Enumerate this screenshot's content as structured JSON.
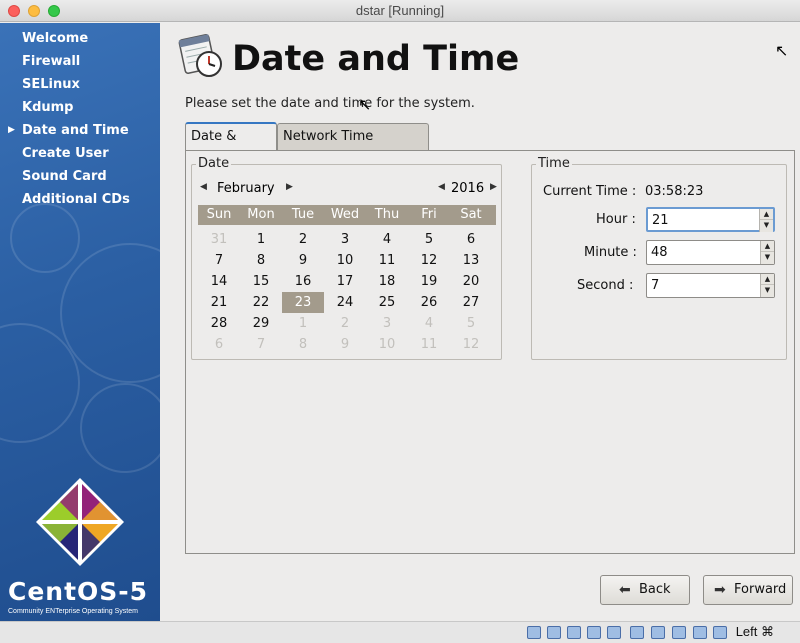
{
  "window": {
    "title": "dstar [Running]"
  },
  "sidebar": {
    "items": [
      {
        "label": "Welcome",
        "current": false
      },
      {
        "label": "Firewall",
        "current": false
      },
      {
        "label": "SELinux",
        "current": false
      },
      {
        "label": "Kdump",
        "current": false
      },
      {
        "label": "Date and Time",
        "current": true
      },
      {
        "label": "Create User",
        "current": false
      },
      {
        "label": "Sound Card",
        "current": false
      },
      {
        "label": "Additional CDs",
        "current": false
      }
    ],
    "brand": "CentOS-5",
    "brand_tagline": "Community ENTerprise Operating System"
  },
  "page": {
    "title": "Date and Time",
    "instruction": "Please set the date and time for the system."
  },
  "tabs": [
    {
      "label": "Date & Time",
      "active": true
    },
    {
      "label": "Network Time Protocol",
      "active": false
    }
  ],
  "date_frame": {
    "label": "Date",
    "month": "February",
    "year": "2016",
    "weekdays": [
      "Sun",
      "Mon",
      "Tue",
      "Wed",
      "Thu",
      "Fri",
      "Sat"
    ],
    "weeks": [
      [
        {
          "d": "31",
          "dim": true
        },
        {
          "d": "1"
        },
        {
          "d": "2"
        },
        {
          "d": "3"
        },
        {
          "d": "4"
        },
        {
          "d": "5"
        },
        {
          "d": "6"
        }
      ],
      [
        {
          "d": "7"
        },
        {
          "d": "8"
        },
        {
          "d": "9"
        },
        {
          "d": "10"
        },
        {
          "d": "11"
        },
        {
          "d": "12"
        },
        {
          "d": "13"
        }
      ],
      [
        {
          "d": "14"
        },
        {
          "d": "15"
        },
        {
          "d": "16"
        },
        {
          "d": "17"
        },
        {
          "d": "18"
        },
        {
          "d": "19"
        },
        {
          "d": "20"
        }
      ],
      [
        {
          "d": "21"
        },
        {
          "d": "22"
        },
        {
          "d": "23",
          "selected": true
        },
        {
          "d": "24"
        },
        {
          "d": "25"
        },
        {
          "d": "26"
        },
        {
          "d": "27"
        }
      ],
      [
        {
          "d": "28"
        },
        {
          "d": "29"
        },
        {
          "d": "1",
          "dim": true
        },
        {
          "d": "2",
          "dim": true
        },
        {
          "d": "3",
          "dim": true
        },
        {
          "d": "4",
          "dim": true
        },
        {
          "d": "5",
          "dim": true
        }
      ],
      [
        {
          "d": "6",
          "dim": true
        },
        {
          "d": "7",
          "dim": true
        },
        {
          "d": "8",
          "dim": true
        },
        {
          "d": "9",
          "dim": true
        },
        {
          "d": "10",
          "dim": true
        },
        {
          "d": "11",
          "dim": true
        },
        {
          "d": "12",
          "dim": true
        }
      ]
    ]
  },
  "time_frame": {
    "label": "Time",
    "current_time_label": "Current Time :",
    "current_time": "03:58:23",
    "hour_label": "Hour :",
    "hour": "21",
    "minute_label": "Minute :",
    "minute": "48",
    "second_label": "Second :",
    "second": "7"
  },
  "buttons": {
    "back": "Back",
    "forward": "Forward"
  },
  "statusbar": {
    "host_key": "Left ⌘"
  },
  "colors": {
    "sidebar": "#2b5fa3",
    "calendar_header": "#a39b8c",
    "tab_accent": "#3677c2"
  }
}
